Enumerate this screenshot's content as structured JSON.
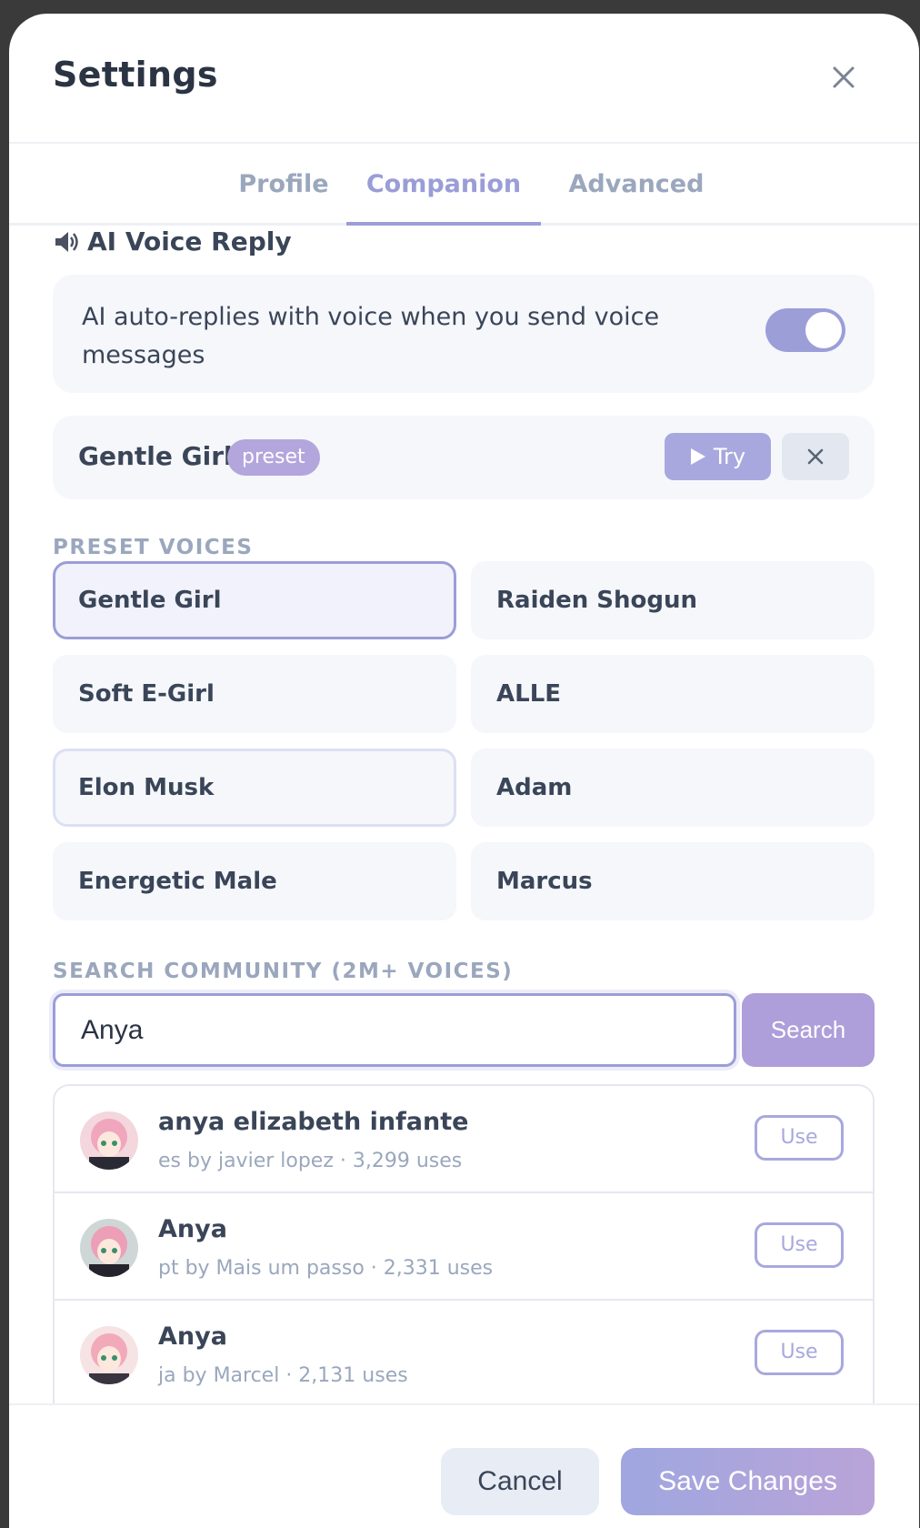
{
  "header": {
    "title": "Settings"
  },
  "tabs": [
    {
      "label": "Profile"
    },
    {
      "label": "Companion"
    },
    {
      "label": "Advanced"
    }
  ],
  "active_tab": "Companion",
  "voice_reply": {
    "icon": "speaker-icon",
    "title": "AI Voice Reply",
    "description": "AI auto-replies with voice when you send voice messages",
    "enabled": true
  },
  "current_voice": {
    "name": "Gentle Girl",
    "badge": "preset",
    "try_label": "Try"
  },
  "preset_section_label": "PRESET VOICES",
  "preset_voices": [
    {
      "name": "Gentle Girl"
    },
    {
      "name": "Raiden Shogun"
    },
    {
      "name": "Soft E-Girl"
    },
    {
      "name": "ALLE"
    },
    {
      "name": "Elon Musk"
    },
    {
      "name": "Adam"
    },
    {
      "name": "Energetic Male"
    },
    {
      "name": "Marcus"
    }
  ],
  "selected_preset": "Gentle Girl",
  "search": {
    "section_label": "SEARCH COMMUNITY (2M+ VOICES)",
    "value": "Anya",
    "button_label": "Search"
  },
  "results": [
    {
      "name": "anya elizabeth infante",
      "meta": "es by javier lopez · 3,299 uses",
      "use_label": "Use"
    },
    {
      "name": "Anya",
      "meta": "pt by Mais um passo · 2,331 uses",
      "use_label": "Use"
    },
    {
      "name": "Anya",
      "meta": "ja by Marcel · 2,131 uses",
      "use_label": "Use"
    }
  ],
  "footer": {
    "cancel_label": "Cancel",
    "save_label": "Save Changes"
  },
  "colors": {
    "accent": "#9b9dd8",
    "badge": "#b3a6dc",
    "muted_text": "#9aa7bd",
    "text": "#3a4558"
  }
}
